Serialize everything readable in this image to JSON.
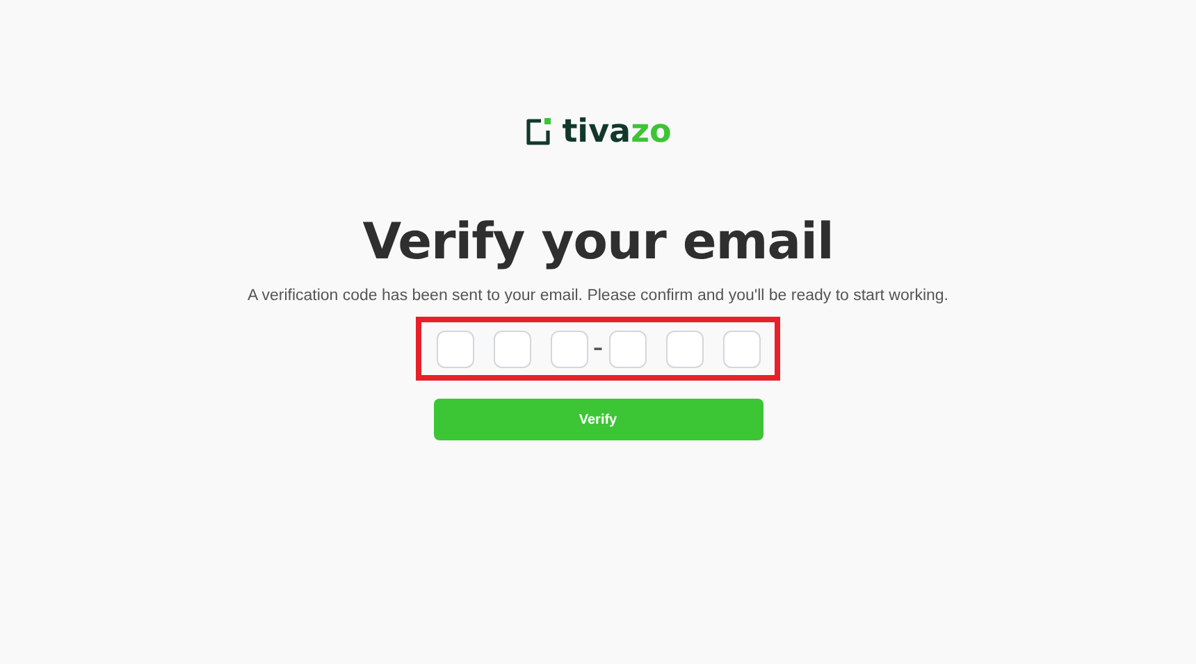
{
  "logo": {
    "dark_part": "tiva",
    "accent_part": "zo"
  },
  "title": "Verify your email",
  "message": "A verification code has been sent to your email. Please confirm and you'll be ready to start working.",
  "code_input": {
    "highlighted": true,
    "separator": "–",
    "digits": [
      {
        "filled": false
      },
      {
        "filled": false
      },
      {
        "filled": false
      },
      {
        "filled": false
      },
      {
        "filled": false
      },
      {
        "filled": false
      }
    ]
  },
  "buttons": [
    {
      "label": "Verify"
    }
  ]
}
